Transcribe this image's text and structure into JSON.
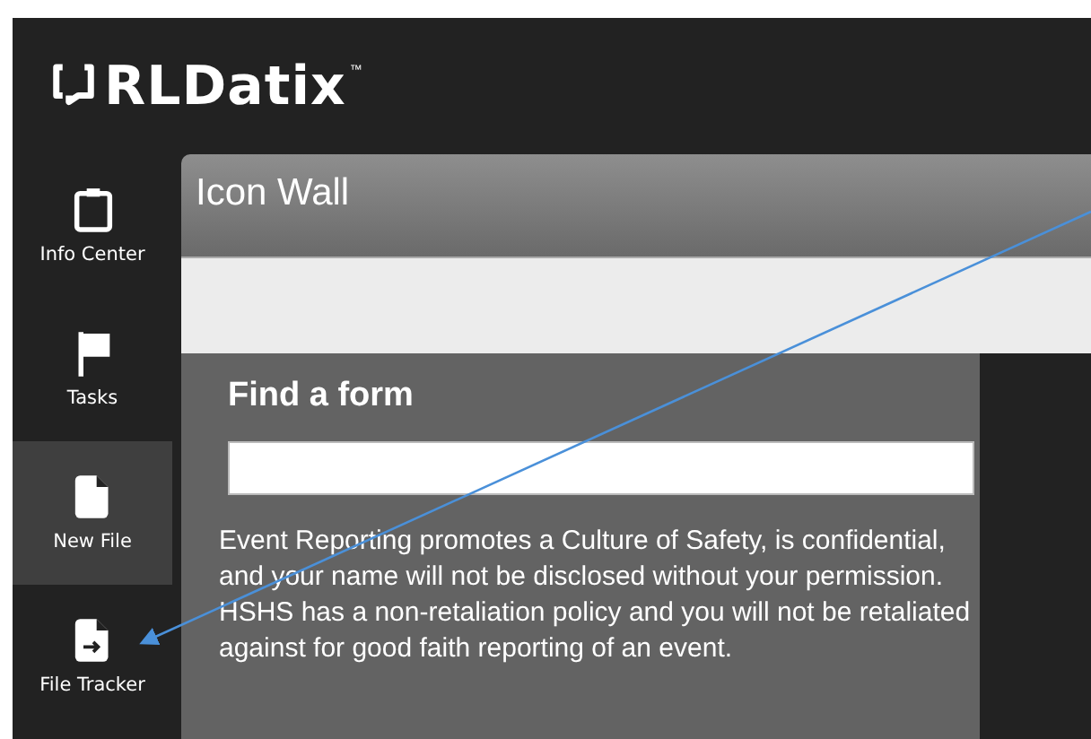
{
  "header": {
    "logo_text": "RLDatix",
    "logo_mark": "™"
  },
  "sidebar": {
    "items": [
      {
        "label": "Info Center",
        "kind": "clipboard",
        "selected": false
      },
      {
        "label": "Tasks",
        "kind": "flag",
        "selected": false
      },
      {
        "label": "New File",
        "kind": "file",
        "selected": true
      },
      {
        "label": "File Tracker",
        "kind": "file-arrow",
        "selected": false
      }
    ]
  },
  "panel": {
    "title": "Icon Wall",
    "search": {
      "heading": "Find a form"
    },
    "notice": "Event Reporting promotes a Culture of Safety, is confidential, and your name will not be disclosed without your permission. HSHS has a non-retaliation policy and you will not be retaliated against for good faith reporting of an event."
  }
}
